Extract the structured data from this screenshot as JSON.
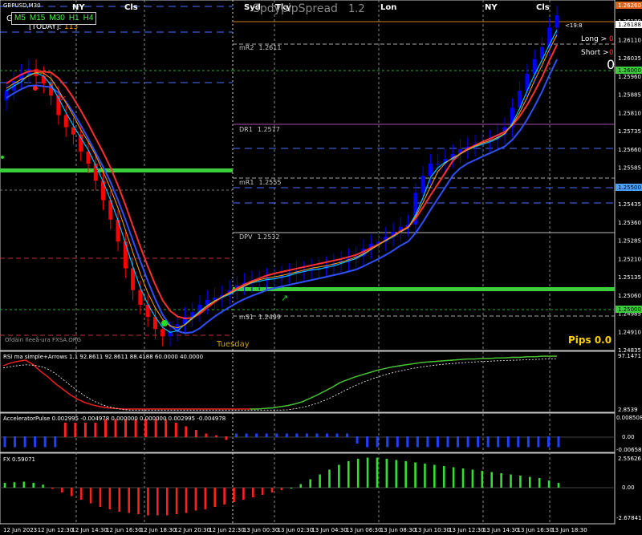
{
  "symbol_title": "GBPUSD,M30",
  "timeframes": [
    "M5",
    "M15",
    "M30",
    "H1",
    "H4"
  ],
  "today_label": "[TODAY]:",
  "today_value": "113",
  "spread_label": "SpdypipSpread",
  "spread_value": "1.2",
  "tuesday_label": "Tuesday",
  "watermark": "Ofdäin ñeeå-ura FXSA.ORG",
  "sessions": [
    "NY",
    "Cls",
    "Syd",
    "Tky",
    "Lon",
    "NY",
    "Cls"
  ],
  "timer": "<19:8",
  "long_label": "Long >",
  "long_value": "0",
  "short_label": "Short >",
  "short_value": "0",
  "big_zero": "0",
  "pips_label": "Pips 0.0",
  "pivots": [
    {
      "name": "mR2",
      "value": "1.2611"
    },
    {
      "name": "DR1",
      "value": "1.2577"
    },
    {
      "name": "mR1",
      "value": "1.2555"
    },
    {
      "name": "DPV",
      "value": "1.2532"
    },
    {
      "name": "mS1",
      "value": "1.2499"
    }
  ],
  "price_labels": [
    "1.26260",
    "1.26188",
    "1.26110",
    "1.26035",
    "1.25960",
    "1.25885",
    "1.25810",
    "1.25735",
    "1.25660",
    "1.25585",
    "1.25510",
    "1.25435",
    "1.25360",
    "1.25285",
    "1.25210",
    "1.25135",
    "1.25060",
    "1.24985",
    "1.24910",
    "1.24835"
  ],
  "highlight_prices": {
    "bid": "1.26188",
    "top": "1.26260",
    "green1": "1.26000",
    "blue": "1.25500",
    "green2": "1.25000"
  },
  "time_labels": [
    "12 Jun 2023",
    "12 Jun 12:30",
    "12 Jun 14:30",
    "12 Jun 16:30",
    "12 Jun 18:30",
    "12 Jun 20:30",
    "12 Jun 22:30",
    "13 Jun 00:30",
    "13 Jun 02:30",
    "13 Jun 04:30",
    "13 Jun 06:30",
    "13 Jun 08:30",
    "13 Jun 10:30",
    "13 Jun 12:30",
    "13 Jun 14:30",
    "13 Jun 16:30",
    "13 Jun 18:30"
  ],
  "rsi": {
    "label": "RSI ma simple+Arrows 1.1 92.8611 92.8611 88.4188 60.0000 40.0000",
    "max": "97.1471",
    "min": "2.8539"
  },
  "ac": {
    "label": "AcceleratorPulse 0.002995 -0.004978 0.000000 0.000000 0.002995 -0.004978",
    "max": "0.008508",
    "mid": "0.00",
    "min": "-0.006582"
  },
  "fx": {
    "label": "FX 0.59071",
    "max": "2.55626",
    "mid": "0.00",
    "min": "-2.67841"
  },
  "colors": {
    "bull": "#0000ff",
    "bear": "#ff0000",
    "green": "#32cd32",
    "cyan": "#00bfff",
    "grid": "#5a5a5a"
  },
  "chart_data": {
    "type": "candlestick",
    "title": "GBPUSD,M30",
    "ylim": [
      1.24835,
      1.2626
    ],
    "close": [
      1.259,
      1.2594,
      1.2597,
      1.2599,
      1.2596,
      1.2593,
      1.2588,
      1.258,
      1.2575,
      1.2572,
      1.2565,
      1.256,
      1.2553,
      1.2545,
      1.2537,
      1.2528,
      1.2517,
      1.2508,
      1.2502,
      1.2497,
      1.2492,
      1.2489,
      1.2491,
      1.2494,
      1.2497,
      1.2499,
      1.2502,
      1.2504,
      1.2505,
      1.2506,
      1.2508,
      1.251,
      1.2511,
      1.2512,
      1.2512,
      1.2513,
      1.2513,
      1.2514,
      1.2515,
      1.2516,
      1.2516,
      1.2517,
      1.2517,
      1.2518,
      1.2519,
      1.252,
      1.2521,
      1.2522,
      1.2525,
      1.2527,
      1.2528,
      1.253,
      1.2532,
      1.2534,
      1.2535,
      1.2548,
      1.2555,
      1.256,
      1.256,
      1.2562,
      1.2564,
      1.2566,
      1.2567,
      1.2568,
      1.2569,
      1.257,
      1.2572,
      1.2575,
      1.2583,
      1.259,
      1.2597,
      1.2603,
      1.2608,
      1.2616,
      1.2621
    ],
    "rsi_fast": [
      80,
      85,
      88,
      90,
      82,
      70,
      60,
      48,
      38,
      28,
      20,
      14,
      10,
      7,
      5,
      4,
      3,
      3,
      3,
      3,
      3,
      3,
      3,
      3,
      3,
      3,
      3,
      3,
      3,
      3,
      3,
      3,
      3,
      3,
      3,
      4,
      5,
      7,
      9,
      12,
      16,
      22,
      28,
      35,
      42,
      50,
      55,
      60,
      64,
      68,
      72,
      75,
      78,
      80,
      82,
      84,
      86,
      87,
      88,
      89,
      90,
      91,
      92,
      92,
      93,
      93,
      94,
      94,
      95,
      95,
      96,
      96,
      97,
      97,
      97
    ],
    "ac": [
      -0.003,
      -0.003,
      -0.003,
      -0.003,
      -0.003,
      -0.003,
      0.004,
      0.004,
      0.004,
      0.004,
      0.005,
      0.005,
      0.005,
      0.005,
      0.005,
      0.005,
      0.005,
      0.004,
      0.003,
      0.002,
      0.001,
      0.0005,
      -0.001,
      0.001,
      0.001,
      0.001,
      0.001,
      0.001,
      0.001,
      0.001,
      0.001,
      0.001,
      0.001,
      0.001,
      0.001,
      -0.002,
      -0.003,
      -0.003,
      -0.003,
      -0.003,
      -0.003,
      -0.003,
      -0.003,
      -0.003,
      -0.003,
      -0.003,
      -0.003,
      -0.003,
      -0.003,
      -0.003,
      -0.003,
      -0.003,
      -0.003,
      -0.003,
      -0.003,
      -0.003
    ],
    "fx": [
      0.4,
      0.45,
      0.5,
      0.4,
      0.25,
      -0.1,
      -0.4,
      -0.7,
      -1.0,
      -1.3,
      -1.6,
      -1.8,
      -2.0,
      -2.1,
      -2.2,
      -2.3,
      -2.3,
      -2.3,
      -2.2,
      -2.1,
      -1.9,
      -1.8,
      -1.6,
      -1.4,
      -1.2,
      -1.0,
      -0.8,
      -0.6,
      -0.4,
      -0.2,
      0,
      0.3,
      0.7,
      1.1,
      1.5,
      1.9,
      2.2,
      2.4,
      2.5,
      2.5,
      2.4,
      2.3,
      2.2,
      2.1,
      2.0,
      1.9,
      1.8,
      1.7,
      1.6,
      1.5,
      1.4,
      1.3,
      1.2,
      1.1,
      1.0,
      0.9,
      0.8,
      0.6,
      0.4
    ]
  }
}
